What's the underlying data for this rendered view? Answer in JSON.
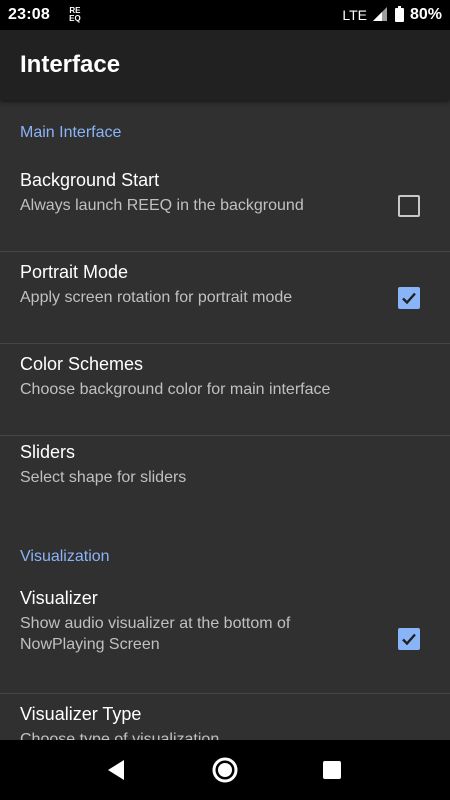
{
  "status_bar": {
    "time": "23:08",
    "app_badge": "REEQ",
    "network": "LTE",
    "battery_percent": "80%"
  },
  "app_bar": {
    "title": "Interface"
  },
  "sections": [
    {
      "header": "Main Interface",
      "items": [
        {
          "title": "Background Start",
          "summary": "Always launch REEQ in the background",
          "checked": false
        },
        {
          "title": "Portrait Mode",
          "summary": "Apply screen rotation for portrait mode",
          "checked": true
        },
        {
          "title": "Color Schemes",
          "summary": "Choose background color for main interface"
        },
        {
          "title": "Sliders",
          "summary": "Select shape for sliders"
        }
      ]
    },
    {
      "header": "Visualization",
      "items": [
        {
          "title": "Visualizer",
          "summary": "Show audio visualizer at the bottom of NowPlaying Screen",
          "checked": true
        },
        {
          "title": "Visualizer Type",
          "summary": "Choose type of visualization"
        }
      ]
    }
  ],
  "colors": {
    "accent": "#8ab4f8",
    "background": "#303030",
    "app_bar": "#212121"
  },
  "nav_bar": {
    "icons": [
      "back-icon",
      "home-icon",
      "recents-icon"
    ]
  }
}
